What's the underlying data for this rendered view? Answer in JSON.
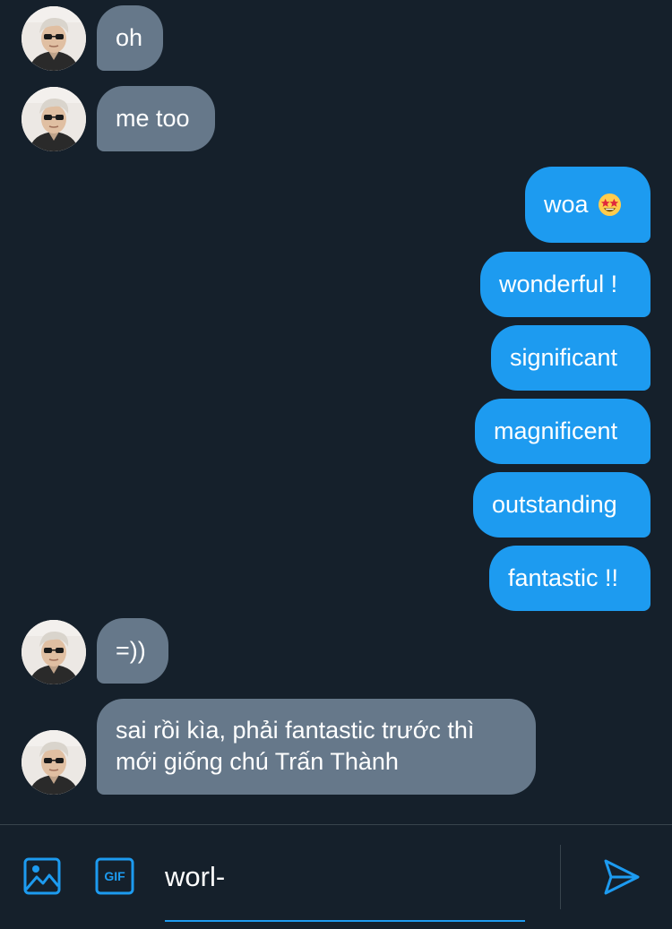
{
  "messages": [
    {
      "direction": "incoming",
      "text": "oh"
    },
    {
      "direction": "incoming",
      "text": "me too"
    },
    {
      "direction": "outgoing",
      "text": "woa",
      "emoji": "🤩"
    },
    {
      "direction": "outgoing",
      "text": "wonderful !"
    },
    {
      "direction": "outgoing",
      "text": "significant"
    },
    {
      "direction": "outgoing",
      "text": "magnificent"
    },
    {
      "direction": "outgoing",
      "text": "outstanding"
    },
    {
      "direction": "outgoing",
      "text": "fantastic !!"
    },
    {
      "direction": "incoming",
      "text": "=))"
    },
    {
      "direction": "incoming",
      "text_lines": [
        "sai rồi kìa, phải fantastic trước thì",
        "mới giống chú Trấn Thành"
      ]
    }
  ],
  "composer": {
    "value": "worl-",
    "image_icon": "image-icon",
    "gif_icon": "gif-icon",
    "gif_label": "GIF",
    "send_icon": "send-icon"
  },
  "colors": {
    "background": "#15202b",
    "incoming_bubble": "#66788a",
    "outgoing_bubble": "#1d9bf0",
    "accent": "#1d9bf0"
  }
}
